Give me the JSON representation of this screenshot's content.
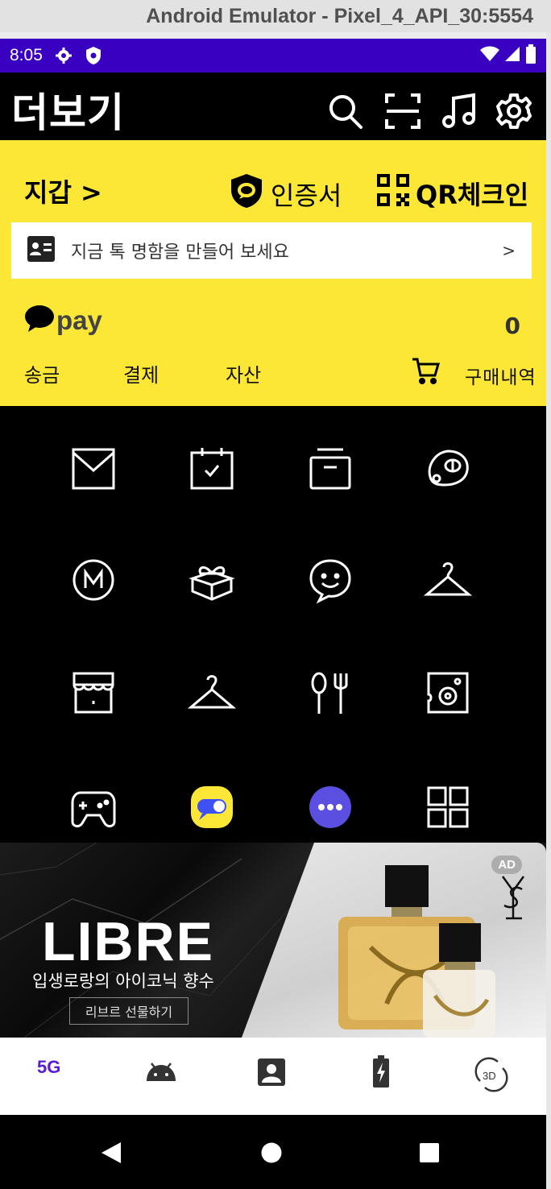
{
  "emulator": {
    "title": "Android Emulator - Pixel_4_API_30:5554"
  },
  "status_bar": {
    "time": "8:05",
    "bg_color": "#3a00c2"
  },
  "header": {
    "title": "더보기",
    "icons": [
      "search-icon",
      "scan-icon",
      "music-icon",
      "settings-icon"
    ]
  },
  "wallet": {
    "title": "지갑 >",
    "certificate_label": "인증서",
    "qr_checkin_label": "QR체크인",
    "namecard_prompt": "지금 톡 명함을 만들어 보세요",
    "namecard_arrow": ">",
    "pay_label": "pay",
    "pay_balance": "0",
    "actions": [
      "송금",
      "결제",
      "자산"
    ],
    "purchase_history": "구매내역",
    "bg_color": "#fde736"
  },
  "services_grid": {
    "icons": [
      "mail-icon",
      "calendar-icon",
      "drawer-icon",
      "emoticon-icon",
      "m-coin-icon",
      "gift-icon",
      "chat-smile-icon",
      "hanger-icon",
      "store-icon",
      "hanger-icon",
      "dining-icon",
      "speaker-icon",
      "gamepad-icon",
      "toggle-app-icon",
      "more-apps-icon",
      "grid-all-icon"
    ]
  },
  "ad": {
    "badge": "AD",
    "brand": "LIBRE",
    "subtitle": "입생로랑의 아이코닉 향수",
    "cta": "리브르 선물하기",
    "logo": "YSL"
  },
  "bottom_tabs": {
    "first_label": "5G",
    "accent": "#5b1bd6",
    "icons": [
      "5g-icon",
      "android-icon",
      "contact-icon",
      "battery-icon",
      "rotate-3d-icon"
    ]
  },
  "nav_bar": {
    "icons": [
      "back-icon",
      "home-icon",
      "recents-icon"
    ]
  }
}
